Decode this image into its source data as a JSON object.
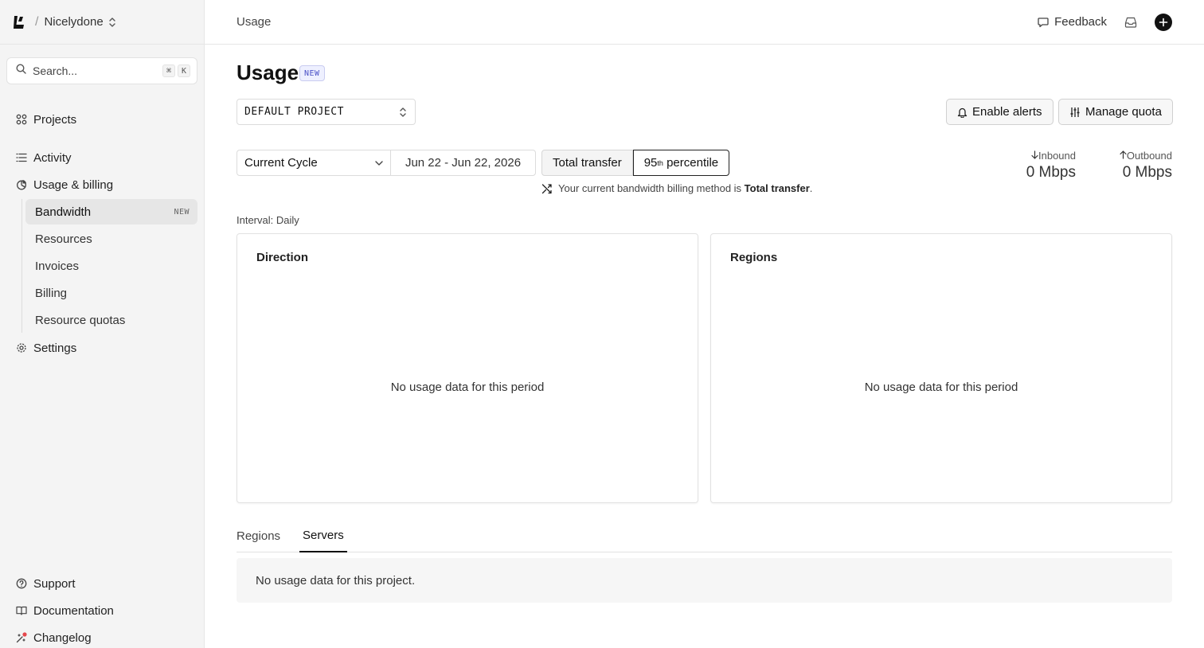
{
  "sidebar": {
    "org_name": "Nicelydone",
    "search": {
      "placeholder": "Search...",
      "kbd_cmd": "⌘",
      "kbd_key": "K"
    },
    "items": {
      "projects": "Projects",
      "activity": "Activity",
      "usage_billing": "Usage & billing",
      "settings": "Settings",
      "support": "Support",
      "documentation": "Documentation",
      "changelog": "Changelog"
    },
    "sub_items": {
      "bandwidth": "Bandwidth",
      "bandwidth_badge": "NEW",
      "resources": "Resources",
      "invoices": "Invoices",
      "billing": "Billing",
      "resource_quotas": "Resource quotas"
    },
    "changelog_dot_color": "#e5484d"
  },
  "topbar": {
    "breadcrumb": "Usage",
    "feedback": "Feedback"
  },
  "main": {
    "title": "Usage",
    "title_badge": "NEW",
    "project_select": "DEFAULT PROJECT",
    "enable_alerts": "Enable alerts",
    "manage_quota": "Manage quota",
    "cycle_select": "Current Cycle",
    "date_range": "Jun 22 - Jun 22, 2026",
    "segment": {
      "total_transfer": "Total transfer",
      "percentile_num": "95",
      "percentile_sup": "th",
      "percentile_word": "percentile"
    },
    "method_note_prefix": "Your current bandwidth billing method is",
    "method_note_value": "Total transfer",
    "method_note_suffix": ".",
    "inbound": {
      "label": "Inbound",
      "value": "0 Mbps"
    },
    "outbound": {
      "label": "Outbound",
      "value": "0 Mbps"
    },
    "interval": "Interval: Daily",
    "cards": {
      "direction_title": "Direction",
      "direction_empty": "No usage data for this period",
      "regions_title": "Regions",
      "regions_empty": "No usage data for this period"
    },
    "tabs": {
      "regions": "Regions",
      "servers": "Servers"
    },
    "table_empty": "No usage data for this project."
  }
}
